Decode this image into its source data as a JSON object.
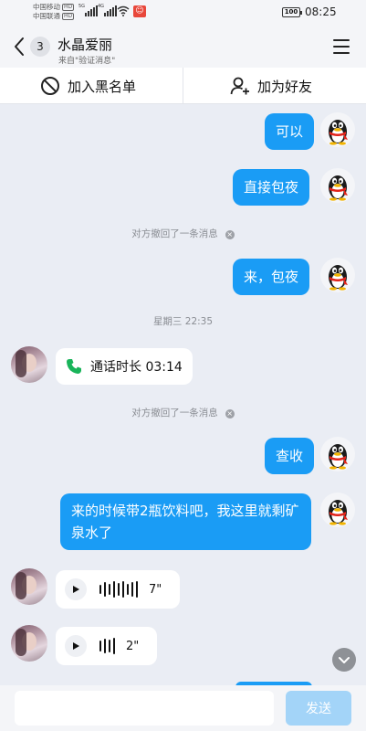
{
  "status": {
    "carrier1": "中国移动",
    "carrier2": "中国联通",
    "hd": "HD",
    "net1": "5G",
    "net2": "4G",
    "battery": "100",
    "time": "08:25"
  },
  "header": {
    "unread": "3",
    "name": "水晶爱丽",
    "source": "来自\"验证消息\""
  },
  "actions": {
    "block": "加入黑名单",
    "add_friend": "加为好友"
  },
  "messages": {
    "m1": "可以",
    "m2": "直接包夜",
    "recall1": "对方撤回了一条消息",
    "m3": "来，包夜",
    "timestamp": "星期三 22:35",
    "call": "通话时长 03:14",
    "recall2": "对方撤回了一条消息",
    "m4": "查收",
    "m5": "来的时候带2瓶饮料吧，我这里就剩矿泉水了",
    "voice1_duration": "7\"",
    "voice2_duration": "2\""
  },
  "input": {
    "placeholder": "",
    "send": "发送"
  },
  "colors": {
    "bubble_out": "#1a9cf5",
    "send_disabled": "#a3d4f8",
    "call_icon": "#19b45a"
  }
}
